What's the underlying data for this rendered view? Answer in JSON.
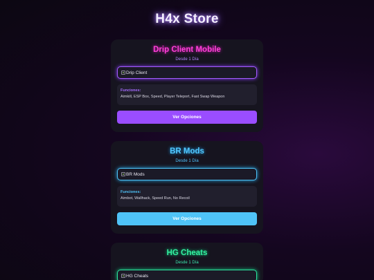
{
  "store": {
    "title": "H4x Store"
  },
  "products": [
    {
      "title": "Drip Client Mobile",
      "subtitle": "Desde 1 Día",
      "image_alt": "Drip Client",
      "features_label": "Funciones:",
      "features": "Aimkill, ESP Box, Speed, Player Teleport, Fast Swap Weapon",
      "button_label": "Ver Opciones",
      "accent_color": "#ff3fd8"
    },
    {
      "title": "BR Mods",
      "subtitle": "Desde 1 Día",
      "image_alt": "BR Mods",
      "features_label": "Funciones:",
      "features": "Aimbot, Wallhack, Speed Run, No Recoil",
      "button_label": "Ver Opciones",
      "accent_color": "#52c8ff"
    },
    {
      "title": "HG Cheats",
      "subtitle": "Desde 1 Día",
      "image_alt": "HG Cheats",
      "accent_color": "#33f0a0"
    }
  ]
}
